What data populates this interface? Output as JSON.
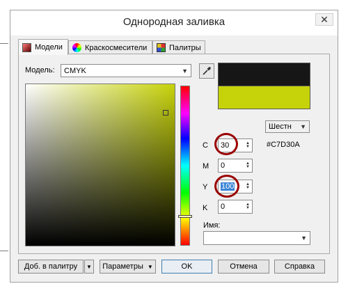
{
  "window": {
    "title": "Однородная заливка",
    "close_glyph": "✕"
  },
  "tabs": [
    {
      "label": "Модели",
      "icon": "color-model-icon",
      "active": true
    },
    {
      "label": "Краскосмесители",
      "icon": "color-wheel-icon",
      "active": false
    },
    {
      "label": "Палитры",
      "icon": "palette-grid-icon",
      "active": false
    }
  ],
  "model": {
    "label": "Модель:",
    "value": "CMYK"
  },
  "preview": {
    "old_color": "#161616",
    "new_color": "#c7d30a"
  },
  "format": {
    "value": "Шестн"
  },
  "hex_value": "#C7D30A",
  "fields": {
    "c": {
      "label": "C",
      "value": "30"
    },
    "m": {
      "label": "M",
      "value": "0"
    },
    "y": {
      "label": "Y",
      "value": "100"
    },
    "k": {
      "label": "K",
      "value": "0"
    }
  },
  "name_field": {
    "label": "Имя:",
    "value": ""
  },
  "buttons": {
    "add_to_palette": "Доб. в палитру",
    "options": "Параметры",
    "ok": "OK",
    "cancel": "Отмена",
    "help": "Справка"
  },
  "annotation_color": "#a00000"
}
